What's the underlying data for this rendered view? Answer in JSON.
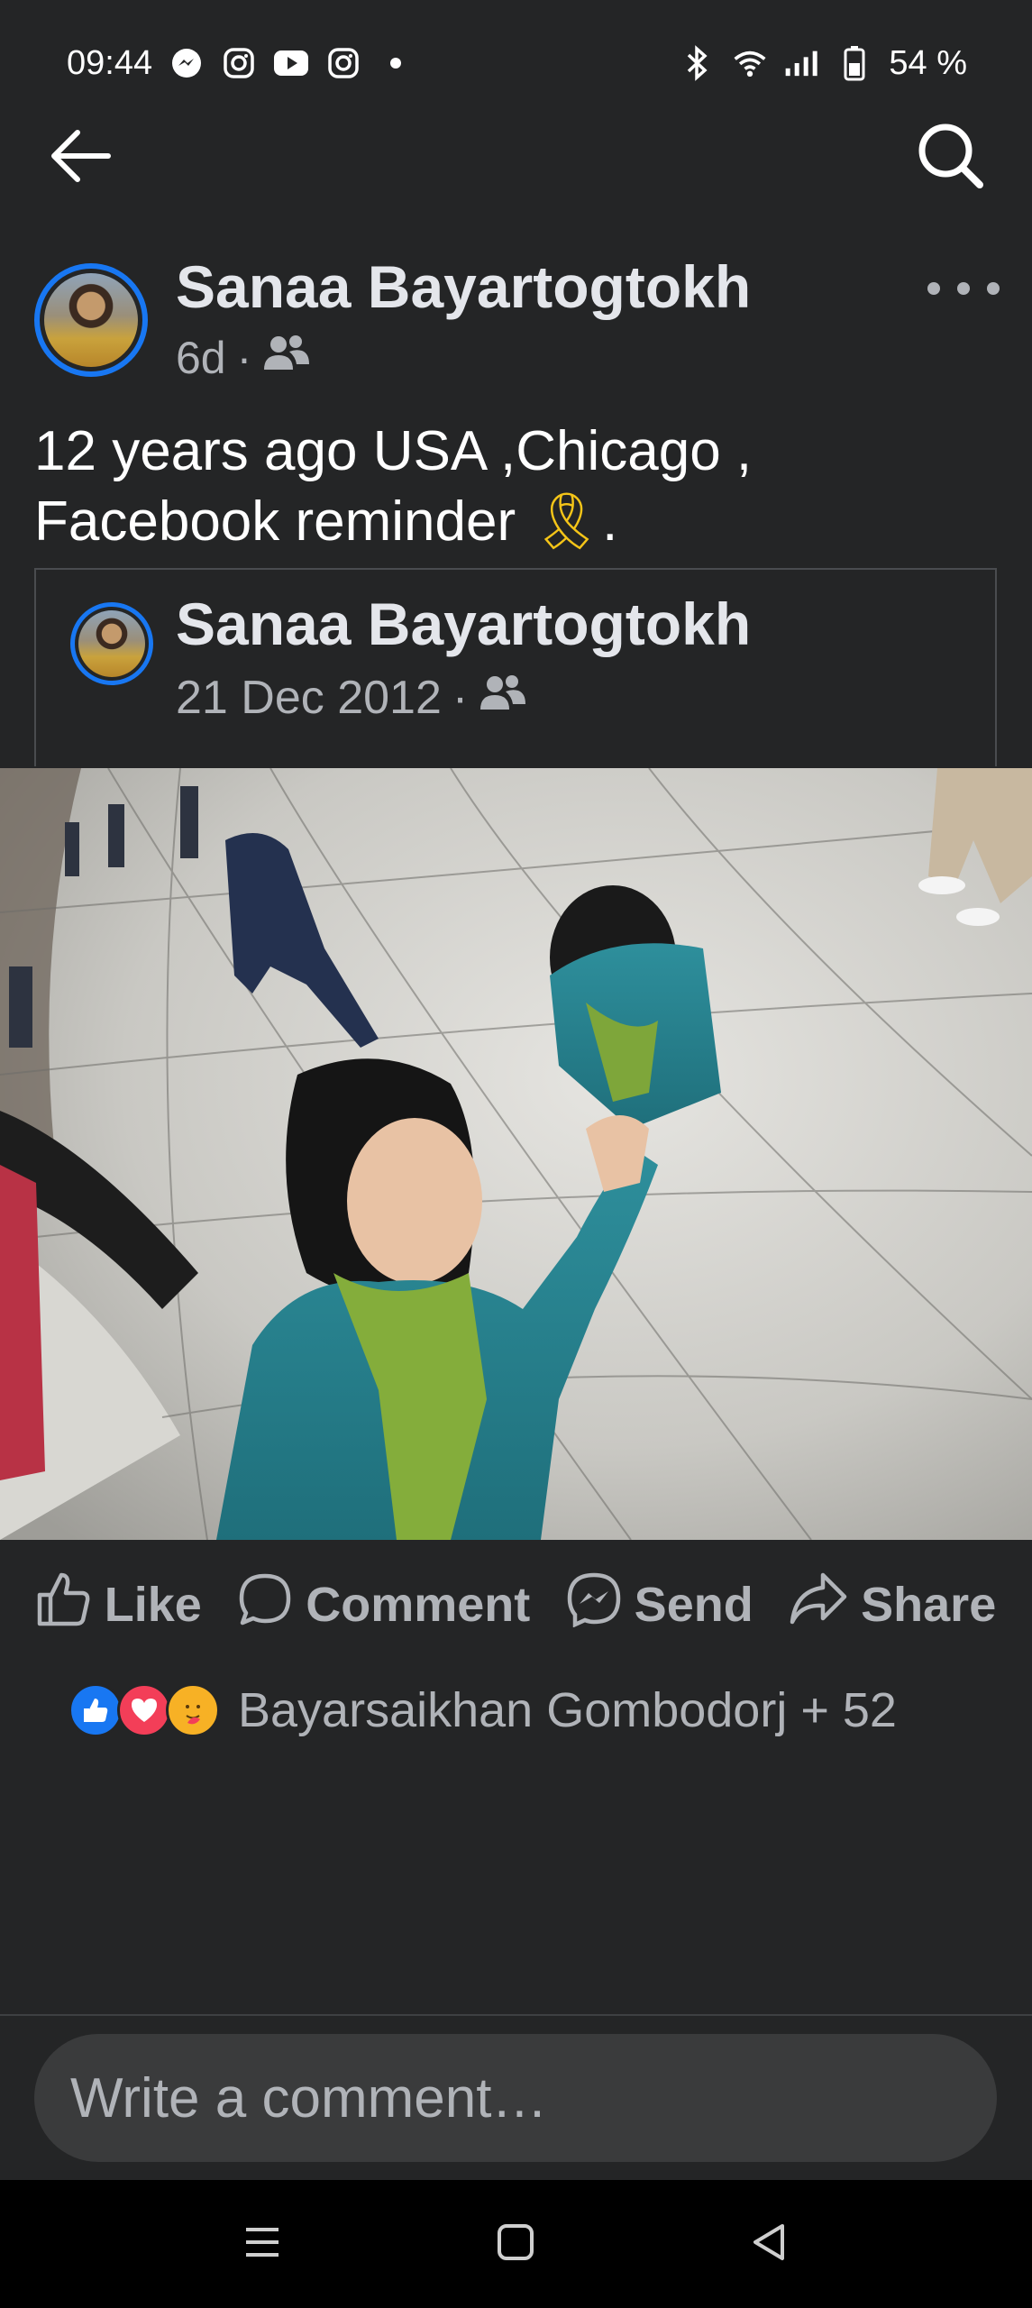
{
  "status_bar": {
    "time": "09:44",
    "battery": "54 %",
    "left_icons": [
      "messenger-icon",
      "instagram-icon",
      "youtube-icon",
      "instagram-icon",
      "dot-icon"
    ],
    "right_icons": [
      "bluetooth-icon",
      "wifi-icon",
      "signal-icon",
      "battery-icon"
    ]
  },
  "nav": {
    "back_icon": "arrow-left-icon",
    "search_icon": "search-icon"
  },
  "post": {
    "author": "Sanaa Bayartogtokh",
    "time": "6d",
    "separator": "·",
    "audience_icon": "friends-icon",
    "text_line1": "12 years ago  USA ,Chicago ,",
    "text_line2": "Facebook reminder ",
    "text_emoji": "🎗",
    "text_end": "."
  },
  "shared": {
    "author": "Sanaa Bayartogtokh",
    "date": "21 Dec 2012",
    "separator": "·",
    "audience_icon": "friends-icon"
  },
  "actions": {
    "like": "Like",
    "comment": "Comment",
    "send": "Send",
    "share": "Share"
  },
  "reactions": {
    "icons": [
      "like-icon",
      "love-icon",
      "care-icon"
    ],
    "text": "Bayarsaikhan Gombodorj + 52"
  },
  "comment_input": {
    "placeholder": "Write a comment…"
  },
  "system_nav": [
    "recents-icon",
    "home-icon",
    "back-icon"
  ],
  "colors": {
    "background": "#242526",
    "accent": "#1877f2",
    "muted": "#b0b3b8"
  }
}
